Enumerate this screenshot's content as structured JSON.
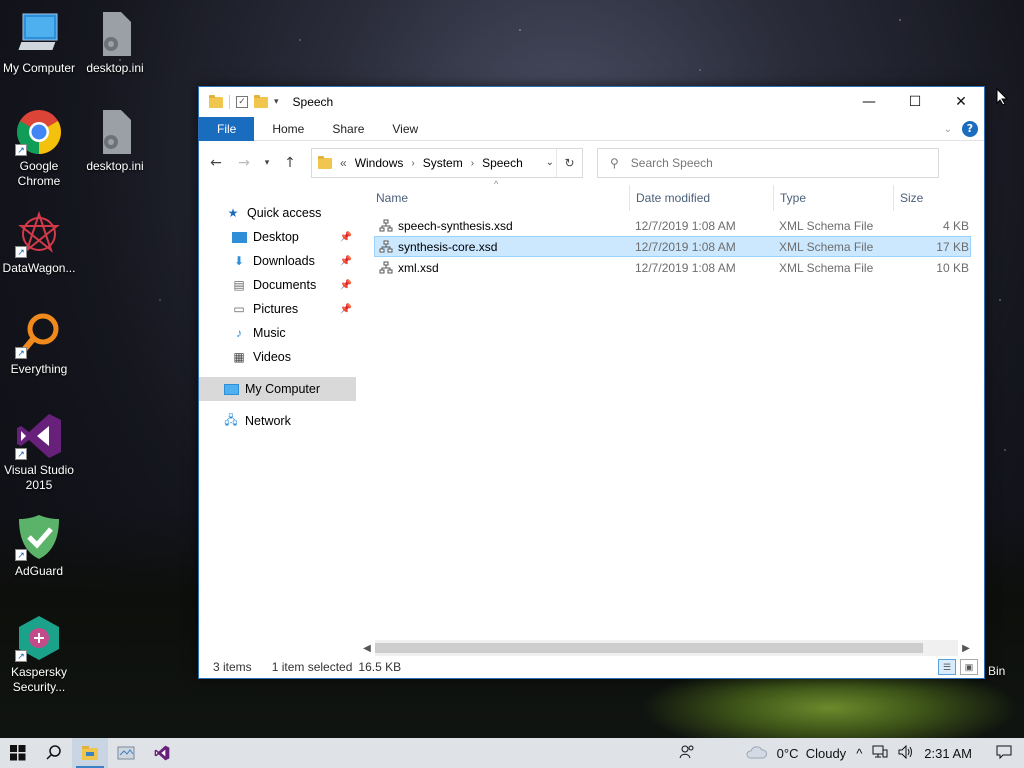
{
  "desktop": {
    "icons": [
      {
        "label": "My Computer",
        "icon": "my-computer-icon"
      },
      {
        "label": "desktop.ini",
        "icon": "ini-file-icon"
      },
      {
        "label": "Google Chrome",
        "icon": "chrome-icon"
      },
      {
        "label": "desktop.ini",
        "icon": "ini-file-icon"
      },
      {
        "label": "DataWagon...",
        "icon": "datawagon-icon"
      },
      {
        "label": "Everything",
        "icon": "everything-search-icon"
      },
      {
        "label": "Visual Studio 2015",
        "icon": "visual-studio-icon"
      },
      {
        "label": "AdGuard",
        "icon": "adguard-icon"
      },
      {
        "label": "Kaspersky Security...",
        "icon": "kaspersky-icon"
      }
    ],
    "recycle_bin_label": "Bin"
  },
  "window": {
    "title": "Speech",
    "controls": {
      "minimize": "—",
      "maximize": "☐",
      "close": "✕"
    },
    "ribbon": {
      "tabs": [
        "File",
        "Home",
        "Share",
        "View"
      ]
    },
    "address": {
      "crumbs": [
        "Windows",
        "System",
        "Speech"
      ],
      "prefix": "«"
    },
    "search": {
      "placeholder": "Search Speech"
    },
    "nav": {
      "quick_access": "Quick access",
      "pinned": [
        "Desktop",
        "Downloads",
        "Documents",
        "Pictures"
      ],
      "unpinned": [
        "Music",
        "Videos"
      ],
      "my_computer": "My Computer",
      "network": "Network"
    },
    "columns": {
      "name": "Name",
      "date": "Date modified",
      "type": "Type",
      "size": "Size"
    },
    "files": [
      {
        "name": "speech-synthesis.xsd",
        "date": "12/7/2019 1:08 AM",
        "type": "XML Schema File",
        "size": "4 KB"
      },
      {
        "name": "synthesis-core.xsd",
        "date": "12/7/2019 1:08 AM",
        "type": "XML Schema File",
        "size": "17 KB"
      },
      {
        "name": "xml.xsd",
        "date": "12/7/2019 1:08 AM",
        "type": "XML Schema File",
        "size": "10 KB"
      }
    ],
    "selected_index": 1,
    "status": {
      "items": "3 items",
      "selected": "1 item selected",
      "size": "16.5 KB"
    }
  },
  "taskbar": {
    "weather": "0°C  Cloudy",
    "time": "2:31 AM"
  },
  "colors": {
    "accent": "#1a6cbf",
    "selection": "#cce8ff",
    "taskbar": "#dfe3e8"
  }
}
